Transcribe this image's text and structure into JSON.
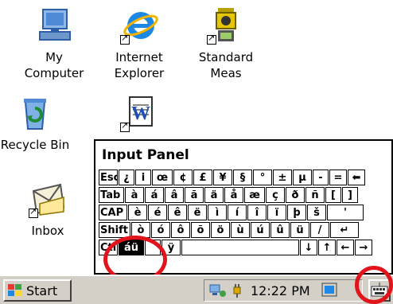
{
  "desktop": {
    "icons": [
      {
        "label": "My\nComputer"
      },
      {
        "label": "Internet\nExplorer"
      },
      {
        "label": "Standard\nMeas"
      },
      {
        "label": "Recycle Bin"
      },
      {
        "label": ""
      },
      {
        "label": "Inbox"
      }
    ]
  },
  "input_panel": {
    "title": "Input Panel",
    "rows": [
      [
        "Esc",
        "¿",
        "i",
        "œ",
        "¢",
        "£",
        "¥",
        "§",
        "°",
        "±",
        "µ",
        "-",
        "=",
        "⬅"
      ],
      [
        "Tab",
        "à",
        "á",
        "â",
        "ã",
        "ä",
        "å",
        "æ",
        "ç",
        "ð",
        "ñ",
        "[",
        "]"
      ],
      [
        "CAP",
        "è",
        "é",
        "ê",
        "ë",
        "ì",
        "í",
        "î",
        "ï",
        "þ",
        "š",
        "'"
      ],
      [
        "Shift",
        "ò",
        "ó",
        "ô",
        "õ",
        "ö",
        "ù",
        "ú",
        "û",
        "ü",
        "/",
        "↵"
      ],
      [
        "Ctl",
        "áü",
        "",
        "ÿ",
        "",
        "↓",
        "↑",
        "←",
        "→"
      ]
    ]
  },
  "taskbar": {
    "start_label": "Start",
    "clock": "12:22 PM"
  },
  "annotation_color": "#e1141b"
}
